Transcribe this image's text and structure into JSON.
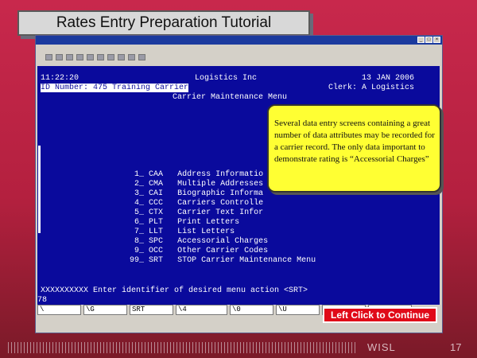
{
  "slide": {
    "title": "Rates Entry Preparation Tutorial",
    "continue_label": "Left Click to Continue",
    "org": "WISL",
    "number": "17"
  },
  "terminal": {
    "time": "11:22:20",
    "company": "Logistics Inc",
    "date": "13 JAN 2006",
    "id_line": "ID Number: 475 Training Carrier",
    "clerk": "Clerk: A Logistics",
    "menu_title": "Carrier Maintenance Menu",
    "menu_items": [
      {
        "num": "1_",
        "code": "CAA",
        "label": "Address Informatio"
      },
      {
        "num": "2_",
        "code": "CMA",
        "label": "Multiple Addresses"
      },
      {
        "num": "3_",
        "code": "CAI",
        "label": "Biographic Informa"
      },
      {
        "num": "4_",
        "code": "CCC",
        "label": "Carriers Controlle"
      },
      {
        "num": "5_",
        "code": "CTX",
        "label": "Carrier Text Infor"
      },
      {
        "num": "6_",
        "code": "PLT",
        "label": "Print Letters"
      },
      {
        "num": "7_",
        "code": "LLT",
        "label": "List Letters"
      },
      {
        "num": "8_",
        "code": "SPC",
        "label": "Accessorial Charges"
      },
      {
        "num": "9_",
        "code": "OCC",
        "label": "Other Carrier Codes"
      },
      {
        "num": "99_",
        "code": "SRT",
        "label": "STOP Carrier Maintenance Menu"
      }
    ],
    "prompt": "XXXXXXXXXX Enter identifier of desired menu action <SRT>",
    "input_value": "78"
  },
  "fields": [
    "\\",
    "\\G",
    "SRT",
    "\\4",
    "\\0",
    "\\U",
    "",
    ""
  ],
  "callout": {
    "text": "Several data entry screens containing a great number of data attributes may be recorded for a carrier record. The only data important to demonstrate rating is “Accessorial Charges”"
  }
}
